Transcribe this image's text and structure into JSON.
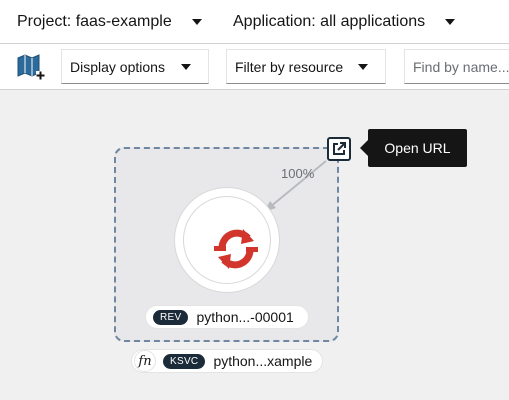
{
  "header": {
    "project_label": "Project: faas-example",
    "application_label": "Application: all applications"
  },
  "toolbar": {
    "display_options_label": "Display options",
    "filter_label": "Filter by resource",
    "search_placeholder": "Find by name..."
  },
  "topology": {
    "traffic_percent": "100%",
    "open_url_tooltip": "Open URL",
    "revision": {
      "badge": "REV",
      "name": "python...-00001"
    },
    "service": {
      "icon_text": "fn",
      "badge": "KSVC",
      "name": "python...xample"
    }
  },
  "colors": {
    "accent_red": "#d1352c",
    "group_border": "#6f87a0",
    "badge_bg": "#1c2b3a",
    "tooltip_bg": "#151515"
  },
  "icons": {
    "toolbar_left": "topology-book-icon",
    "node": "openshift-serverless-logo",
    "url": "external-link-icon"
  }
}
